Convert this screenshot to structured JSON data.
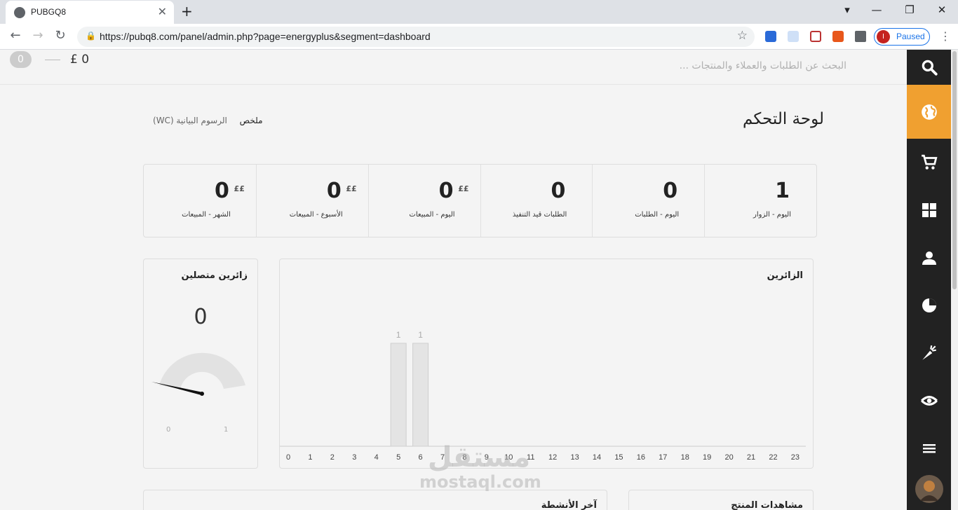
{
  "browser": {
    "tab_title": "PUBGQ8",
    "url": "https://pubq8.com/panel/admin.php?page=energyplus&segment=dashboard",
    "profile_label": "Paused",
    "profile_initial": "I"
  },
  "topbar": {
    "cart_count": "0",
    "cart_total": "£ 0",
    "search_placeholder": "البحث عن الطلبات والعملاء والمنتجات ..."
  },
  "sidebar": {
    "items": [
      "search-icon",
      "globe-icon",
      "cart-icon",
      "grid-icon",
      "user-icon",
      "pie-chart-icon",
      "carrot-icon",
      "eye-icon",
      "menu-icon",
      "avatar"
    ],
    "active": "globe-icon",
    "active_color": "#f0a030"
  },
  "header": {
    "title": "لوحة التحكم",
    "tabs": [
      {
        "label": "ملخص"
      },
      {
        "label": "الرسوم البيانية (WC)"
      }
    ]
  },
  "stats": [
    {
      "value": "1",
      "caption": "اليوم - الزوار",
      "currency": ""
    },
    {
      "value": "0",
      "caption": "اليوم - الطلبات",
      "currency": ""
    },
    {
      "value": "0",
      "caption": "الطلبات قيد التنفيذ",
      "currency": ""
    },
    {
      "value": "0",
      "caption": "اليوم - المبيعات",
      "currency": "££"
    },
    {
      "value": "0",
      "caption": "الأسبوع - المبيعات",
      "currency": "££"
    },
    {
      "value": "0",
      "caption": "الشهر - المبيعات",
      "currency": "££"
    }
  ],
  "gauge": {
    "title": "زائرين متصلين",
    "value": "0",
    "min": "0",
    "max": "1"
  },
  "visitors_chart": {
    "title": "الزائرين"
  },
  "chart_data": {
    "type": "bar",
    "title": "الزائرين",
    "categories": [
      "0",
      "1",
      "2",
      "3",
      "4",
      "5",
      "6",
      "7",
      "8",
      "9",
      "10",
      "11",
      "12",
      "13",
      "14",
      "15",
      "16",
      "17",
      "18",
      "19",
      "20",
      "21",
      "22",
      "23"
    ],
    "values": [
      0,
      0,
      0,
      0,
      0,
      1,
      1,
      0,
      0,
      0,
      0,
      0,
      0,
      0,
      0,
      0,
      0,
      0,
      0,
      0,
      0,
      0,
      0,
      0
    ],
    "xlabel": "",
    "ylabel": "",
    "ylim": [
      0,
      1
    ]
  },
  "bottom": {
    "activity_title": "آخر الأنشطة",
    "product_views_title": "مشاهدات المنتج"
  },
  "watermark": {
    "arabic": "مستقل",
    "latin": "mostaql.com"
  }
}
